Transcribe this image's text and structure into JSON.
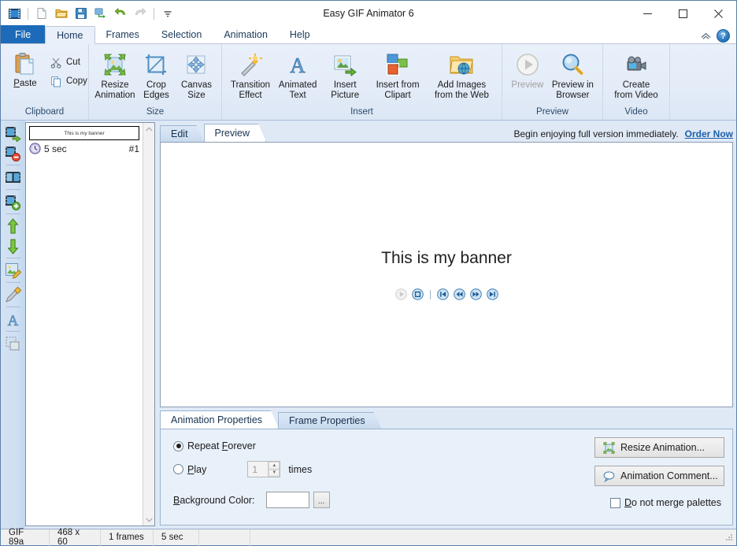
{
  "window": {
    "title": "Easy GIF Animator 6",
    "minimize_label": "Minimize",
    "maximize_label": "Maximize",
    "close_label": "Close"
  },
  "quick_access": {
    "items": [
      {
        "name": "app-icon",
        "label": "Easy GIF Animator"
      },
      {
        "name": "new-icon",
        "label": "New"
      },
      {
        "name": "open-icon",
        "label": "Open"
      },
      {
        "name": "save-icon",
        "label": "Save"
      },
      {
        "name": "export-icon",
        "label": "Export"
      },
      {
        "name": "undo-icon",
        "label": "Undo"
      },
      {
        "name": "redo-icon",
        "label": "Redo"
      },
      {
        "name": "customize-icon",
        "label": "Customize Quick Access Toolbar"
      }
    ]
  },
  "ribbon": {
    "tabs": [
      {
        "label": "File",
        "active": false,
        "file": true
      },
      {
        "label": "Home",
        "active": true,
        "file": false
      },
      {
        "label": "Frames",
        "active": false,
        "file": false
      },
      {
        "label": "Selection",
        "active": false,
        "file": false
      },
      {
        "label": "Animation",
        "active": false,
        "file": false
      },
      {
        "label": "Help",
        "active": false,
        "file": false
      }
    ],
    "collapse_label": "Minimize the Ribbon",
    "help_label": "?",
    "groups": [
      {
        "name": "clipboard",
        "label": "Clipboard",
        "paste": "Paste",
        "cut": "Cut",
        "copy": "Copy"
      },
      {
        "name": "size",
        "label": "Size",
        "buttons": [
          {
            "label": "Resize\nAnimation",
            "line1": "Resize",
            "line2": "Animation"
          },
          {
            "label": "Crop Edges",
            "line1": "Crop",
            "line2": "Edges"
          },
          {
            "label": "Canvas Size",
            "line1": "Canvas",
            "line2": "Size"
          }
        ]
      },
      {
        "name": "insert",
        "label": "Insert",
        "buttons": [
          {
            "line1": "Transition",
            "line2": "Effect"
          },
          {
            "line1": "Animated",
            "line2": "Text"
          },
          {
            "line1": "Insert",
            "line2": "Picture"
          },
          {
            "line1": "Insert from",
            "line2": "Clipart"
          },
          {
            "line1": "Add Images",
            "line2": "from the Web"
          }
        ]
      },
      {
        "name": "preview",
        "label": "Preview",
        "buttons": [
          {
            "line1": "Preview",
            "line2": "",
            "disabled": true
          },
          {
            "line1": "Preview in",
            "line2": "Browser",
            "disabled": false
          }
        ]
      },
      {
        "name": "video",
        "label": "Video",
        "buttons": [
          {
            "line1": "Create",
            "line2": "from Video"
          }
        ]
      }
    ]
  },
  "toolstrip": {
    "tools": [
      {
        "name": "add-frame-icon",
        "label": "Add Frame"
      },
      {
        "name": "delete-frame-icon",
        "label": "Delete Frame"
      },
      {
        "name": "duplicate-frame-icon",
        "label": "Duplicate Frame"
      },
      {
        "name": "insert-frame-icon",
        "label": "Insert Frame"
      },
      {
        "name": "move-frame-up-icon",
        "label": "Move Frame Up"
      },
      {
        "name": "move-frame-down-icon",
        "label": "Move Frame Down"
      },
      {
        "name": "edit-frame-icon",
        "label": "Edit Frame"
      },
      {
        "name": "eyedropper-icon",
        "label": "Color Picker"
      },
      {
        "name": "text-tool-icon",
        "label": "Text Tool"
      },
      {
        "name": "selection-tool-icon",
        "label": "Selection Tool"
      }
    ]
  },
  "frames": {
    "items": [
      {
        "thumb_text": "This is my banner",
        "duration": "5 sec",
        "number": "#1"
      }
    ],
    "scroll_up": "▲",
    "scroll_down": "▼"
  },
  "editor": {
    "tabs": [
      {
        "label": "Edit",
        "active": false
      },
      {
        "label": "Preview",
        "active": true
      }
    ],
    "promo_text": "Begin enjoying full version immediately.",
    "order_link": "Order Now",
    "canvas_text": "This is my banner",
    "playback": [
      {
        "name": "play-button",
        "glyph": "▶",
        "disabled": true
      },
      {
        "name": "stop-button",
        "glyph": "■",
        "disabled": false
      },
      {
        "name": "first-frame-button",
        "glyph": "first",
        "disabled": false
      },
      {
        "name": "previous-frame-button",
        "glyph": "prev",
        "disabled": false
      },
      {
        "name": "next-frame-button",
        "glyph": "next",
        "disabled": false
      },
      {
        "name": "last-frame-button",
        "glyph": "last",
        "disabled": false
      }
    ]
  },
  "properties": {
    "tabs": [
      {
        "label": "Animation Properties",
        "active": true
      },
      {
        "label": "Frame Properties",
        "active": false
      }
    ],
    "repeat_forever": {
      "pre": "Repeat ",
      "accel": "F",
      "post": "orever",
      "selected": true
    },
    "play": {
      "pre": "",
      "accel": "P",
      "post": "lay",
      "selected": false
    },
    "play_count_value": "1",
    "times_label": "times",
    "background_color": {
      "accel": "B",
      "post": "ackground Color:",
      "value": "",
      "browse_label": "..."
    },
    "resize_animation_button": "Resize Animation...",
    "animation_comment_button": "Animation Comment...",
    "do_not_merge": {
      "accel": "D",
      "post": "o not merge palettes",
      "checked": false
    }
  },
  "statusbar": {
    "format": "GIF 89a",
    "dimensions": "468 x 60",
    "frame_count": "1 frames",
    "duration": "5 sec",
    "extra1": "",
    "extra2": ""
  },
  "colors": {
    "accent": "#1d6bb8",
    "ribbon_bg": "#e4ecf8",
    "link": "#1b5fa8",
    "panel_bg": "#e8f0fa"
  }
}
